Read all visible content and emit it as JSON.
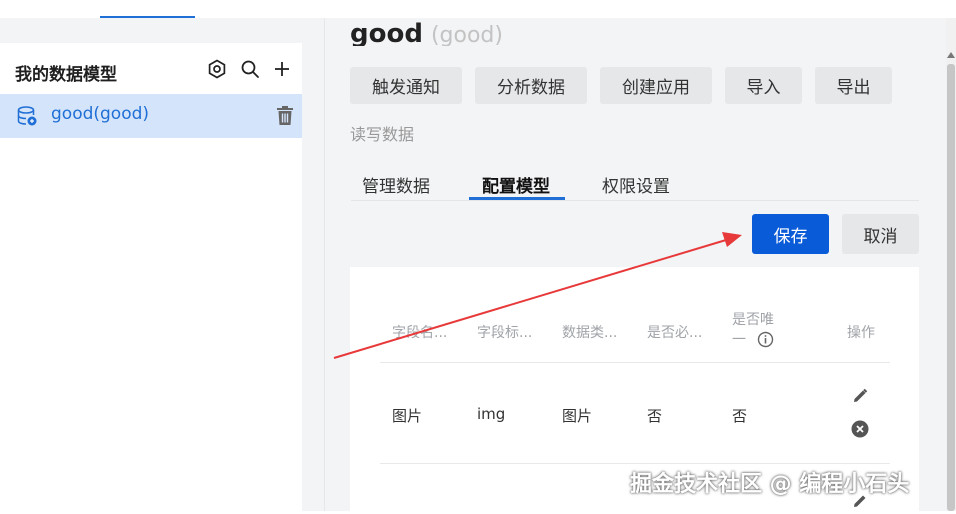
{
  "left": {
    "title": "我的数据模型",
    "models": [
      {
        "label": "good(good)"
      }
    ]
  },
  "header": {
    "title": "good",
    "title_suffix": "(good)"
  },
  "actions": [
    "触发通知",
    "分析数据",
    "创建应用",
    "导入",
    "导出"
  ],
  "permission": "读写数据",
  "tabs": [
    {
      "label": "管理数据",
      "active": false
    },
    {
      "label": "配置模型",
      "active": true
    },
    {
      "label": "权限设置",
      "active": false
    }
  ],
  "form_buttons": {
    "save": "保存",
    "cancel": "取消"
  },
  "table": {
    "headers": [
      "字段名...",
      "字段标...",
      "数据类...",
      "是否必...",
      "是否唯一",
      "操作"
    ],
    "rows": [
      [
        "图片",
        "img",
        "图片",
        "否",
        "否"
      ]
    ]
  },
  "watermark": "掘金技术社区 @ 编程小石头",
  "colors": {
    "accent": "#1f6fd6",
    "primary_button": "#0a5bd8",
    "arrow": "#e8393a"
  }
}
